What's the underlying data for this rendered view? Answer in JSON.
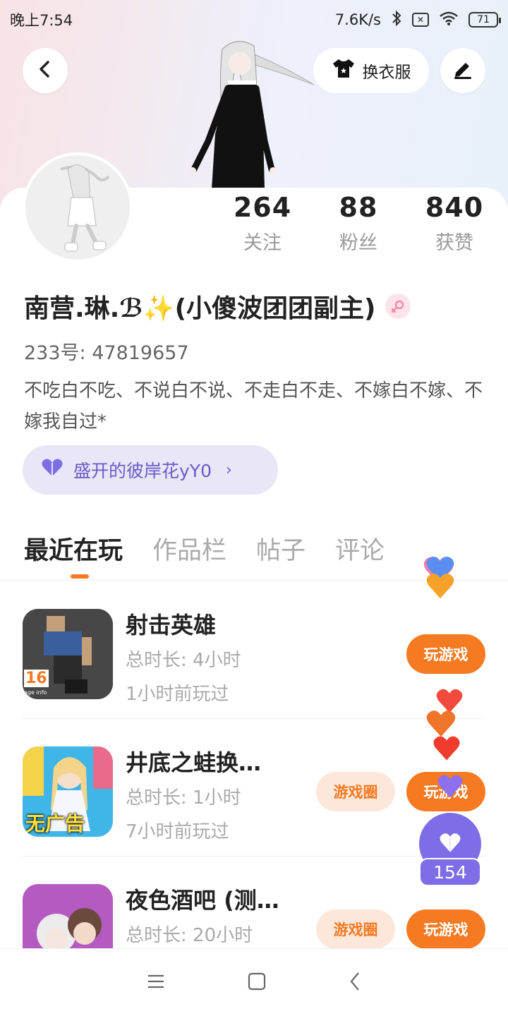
{
  "status_bar": {
    "time": "晚上7:54",
    "network_speed": "7.6K/s",
    "battery": "71",
    "sim": "✕"
  },
  "header": {
    "outfit_button_label": "换衣服"
  },
  "stats": [
    {
      "value": "264",
      "label": "关注"
    },
    {
      "value": "88",
      "label": "粉丝"
    },
    {
      "value": "840",
      "label": "获赞"
    }
  ],
  "profile": {
    "nickname": "南营.琳.ℬ✨(小傻波团团副主)",
    "uid": "233号: 47819657",
    "bio": "不吃白不吃、不说白不说、不走白不走、不嫁白不嫁、不嫁我自过*",
    "guild_name": "盛开的彼岸花yY0",
    "guild_arrow": "›"
  },
  "tabs": [
    "最近在玩",
    "作品栏",
    "帖子",
    "评论"
  ],
  "games": [
    {
      "title": "射击英雄",
      "duration": "总时长: 4小时",
      "last_played": "1小时前玩过",
      "circle_label": "",
      "play_label": "玩游戏",
      "icon_badge": "16",
      "icon_badge_sub": "age info"
    },
    {
      "title": "井底之蛙换…",
      "duration": "总时长: 1小时",
      "last_played": "7小时前玩过",
      "circle_label": "游戏圈",
      "play_label": "玩游戏",
      "icon_badge": "无广告"
    },
    {
      "title": "夜色酒吧 (测…",
      "duration": "总时长: 20小时",
      "last_played": "",
      "circle_label": "游戏圈",
      "play_label": "玩游戏"
    }
  ],
  "like_widget": {
    "count": "154"
  },
  "colors": {
    "accent": "#f57a22",
    "purple": "#7d6de6",
    "guild_bg": "#e9e6f7"
  }
}
